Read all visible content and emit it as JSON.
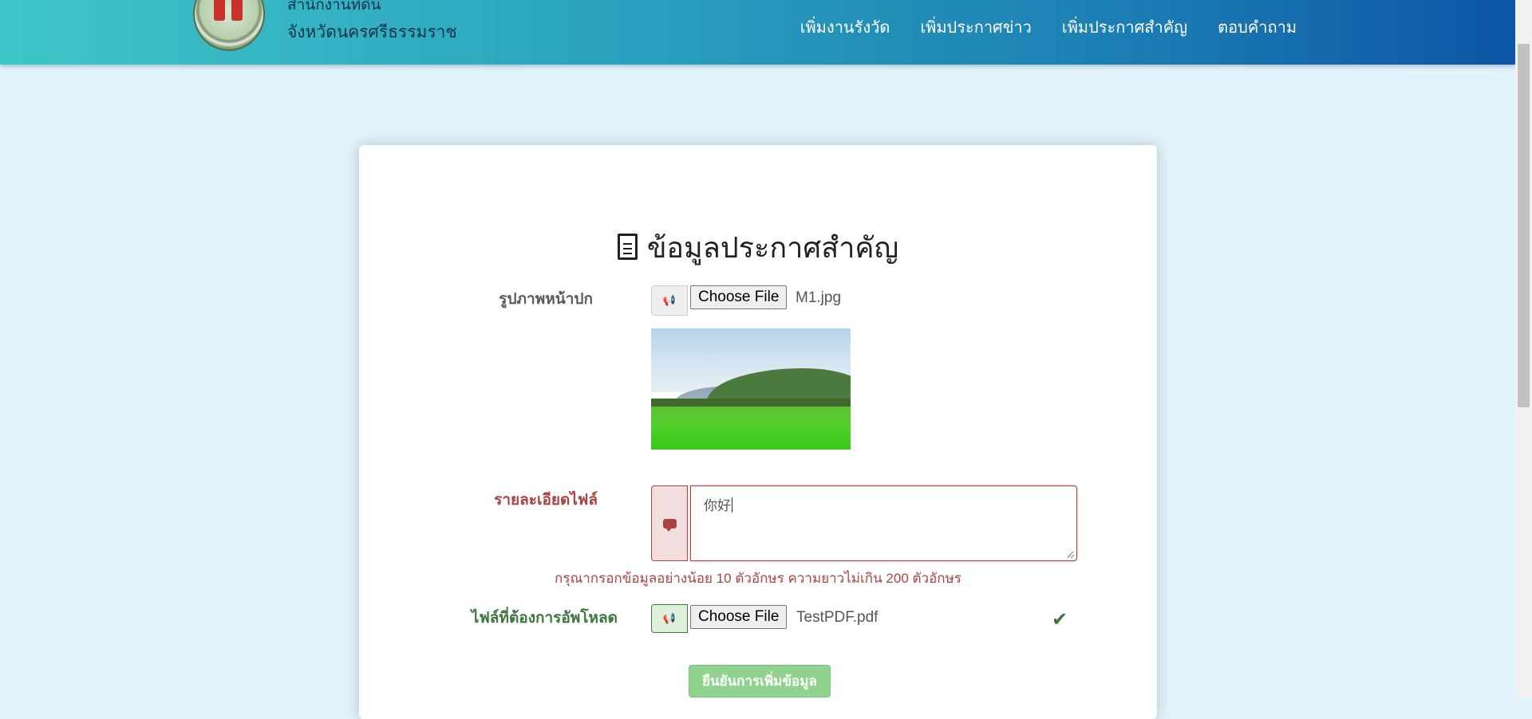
{
  "header": {
    "brand_line1": "สำนักงานที่ดิน",
    "brand_line2": "จังหวัดนครศรีธรรมราช",
    "nav": [
      "เพิ่มงานรังวัด",
      "เพิ่มประกาศข่าว",
      "เพิ่มประกาศสำคัญ",
      "ตอบคำถาม"
    ]
  },
  "form": {
    "title": "ข้อมูลประกาศสำคัญ",
    "title_icon": "file-text-icon",
    "cover": {
      "label": "รูปภาพหน้าปก",
      "icon": "megaphone-icon",
      "button": "Choose File",
      "filename": "M1.jpg"
    },
    "detail": {
      "label": "รายละเอียดไฟล์",
      "icon": "comment-icon",
      "value": "你好",
      "help": "กรุณากรอกข้อมูลอย่างน้อย 10 ตัวอักษร ความยาวไม่เกิน 200 ตัวอักษร"
    },
    "upload": {
      "label": "ไฟล์ที่ต้องการอัพโหลด",
      "icon": "megaphone-icon",
      "button": "Choose File",
      "filename": "TestPDF.pdf",
      "status_icon": "check-icon"
    },
    "submit": "ยืนยันการเพิ่มข้อมูล"
  },
  "colors": {
    "page_bg": "#e1f4fd",
    "error": "#a94442",
    "success": "#3c763d",
    "submit": "#8fd38f"
  }
}
